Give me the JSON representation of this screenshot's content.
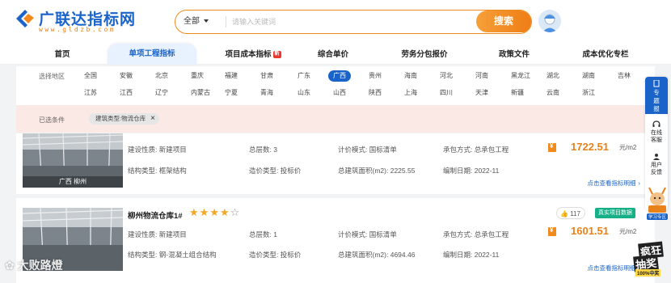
{
  "header": {
    "logo_title": "广联达指标网",
    "logo_url": "www.gldzb.com",
    "search_select": "全部",
    "search_placeholder": "请输入关键词",
    "search_button": "搜索"
  },
  "nav": {
    "items": [
      {
        "label": "首页"
      },
      {
        "label": "单项工程指标"
      },
      {
        "label": "项目成本指标",
        "badge": "新"
      },
      {
        "label": "综合单价"
      },
      {
        "label": "劳务分包报价"
      },
      {
        "label": "政策文件"
      },
      {
        "label": "成本优化专栏"
      }
    ],
    "active_index": 1
  },
  "region_filter": {
    "label": "选择地区",
    "row1": [
      "全国",
      "安徽",
      "北京",
      "重庆",
      "福建",
      "甘肃",
      "广东",
      "广西",
      "贵州",
      "海南",
      "河北",
      "河南",
      "黑龙江",
      "湖北",
      "湖南",
      "吉林"
    ],
    "row2": [
      "江苏",
      "江西",
      "辽宁",
      "内蒙古",
      "宁夏",
      "青海",
      "山东",
      "山西",
      "陕西",
      "上海",
      "四川",
      "天津",
      "新疆",
      "云南",
      "浙江"
    ],
    "active": "广西"
  },
  "selected_conditions": {
    "label": "已选条件",
    "chip": "建筑类型:物流仓库"
  },
  "cards": [
    {
      "thumb_caption": "广西 柳州",
      "fields": {
        "build_nature_label": "建设性质:",
        "build_nature": "新建项目",
        "floors_label": "总层数:",
        "floors": "3",
        "pricing_label": "计价模式:",
        "pricing": "国标清单",
        "contract_label": "承包方式:",
        "contract": "总承包工程",
        "structure_label": "结构类型:",
        "structure": "框架结构",
        "cost_type_label": "造价类型:",
        "cost_type": "投标价",
        "area_label": "总建筑面积(m2):",
        "area": "2225.55",
        "date_label": "编制日期:",
        "date": "2022-11"
      },
      "price": "1722.51",
      "price_unit": "元/m2",
      "detail_link": "点击查看指标明细"
    },
    {
      "title": "柳州物流仓库1#",
      "stars": 4,
      "likes": "117",
      "badge": "真实项目数据",
      "fields": {
        "build_nature_label": "建设性质:",
        "build_nature": "新建项目",
        "floors_label": "总层数:",
        "floors": "1",
        "pricing_label": "计价模式:",
        "pricing": "国标清单",
        "contract_label": "承包方式:",
        "contract": "总承包工程",
        "structure_label": "结构类型:",
        "structure": "钢-混凝土组合结构",
        "cost_type_label": "造价类型:",
        "cost_type": "投标价",
        "area_label": "总建筑面积(m2):",
        "area": "4694.46",
        "date_label": "编制日期:",
        "date": "2022-11"
      },
      "price": "1601.51",
      "price_unit": "元/m2",
      "detail_link": "点击查看指标明细"
    }
  ],
  "float_bar": {
    "topic": "专题报告",
    "service": "在线客服",
    "feedback": "用户反馈",
    "mascot_label": "学习专区",
    "lottery_line1": "疯狂",
    "lottery_line2": "抽奖",
    "lottery_line3": "100%中奖"
  },
  "watermark": "大败路燈",
  "colors": {
    "brand_blue": "#1a63c8",
    "accent_orange": "#ef7d15",
    "badge_green": "#15b088",
    "star": "#f5a623"
  }
}
